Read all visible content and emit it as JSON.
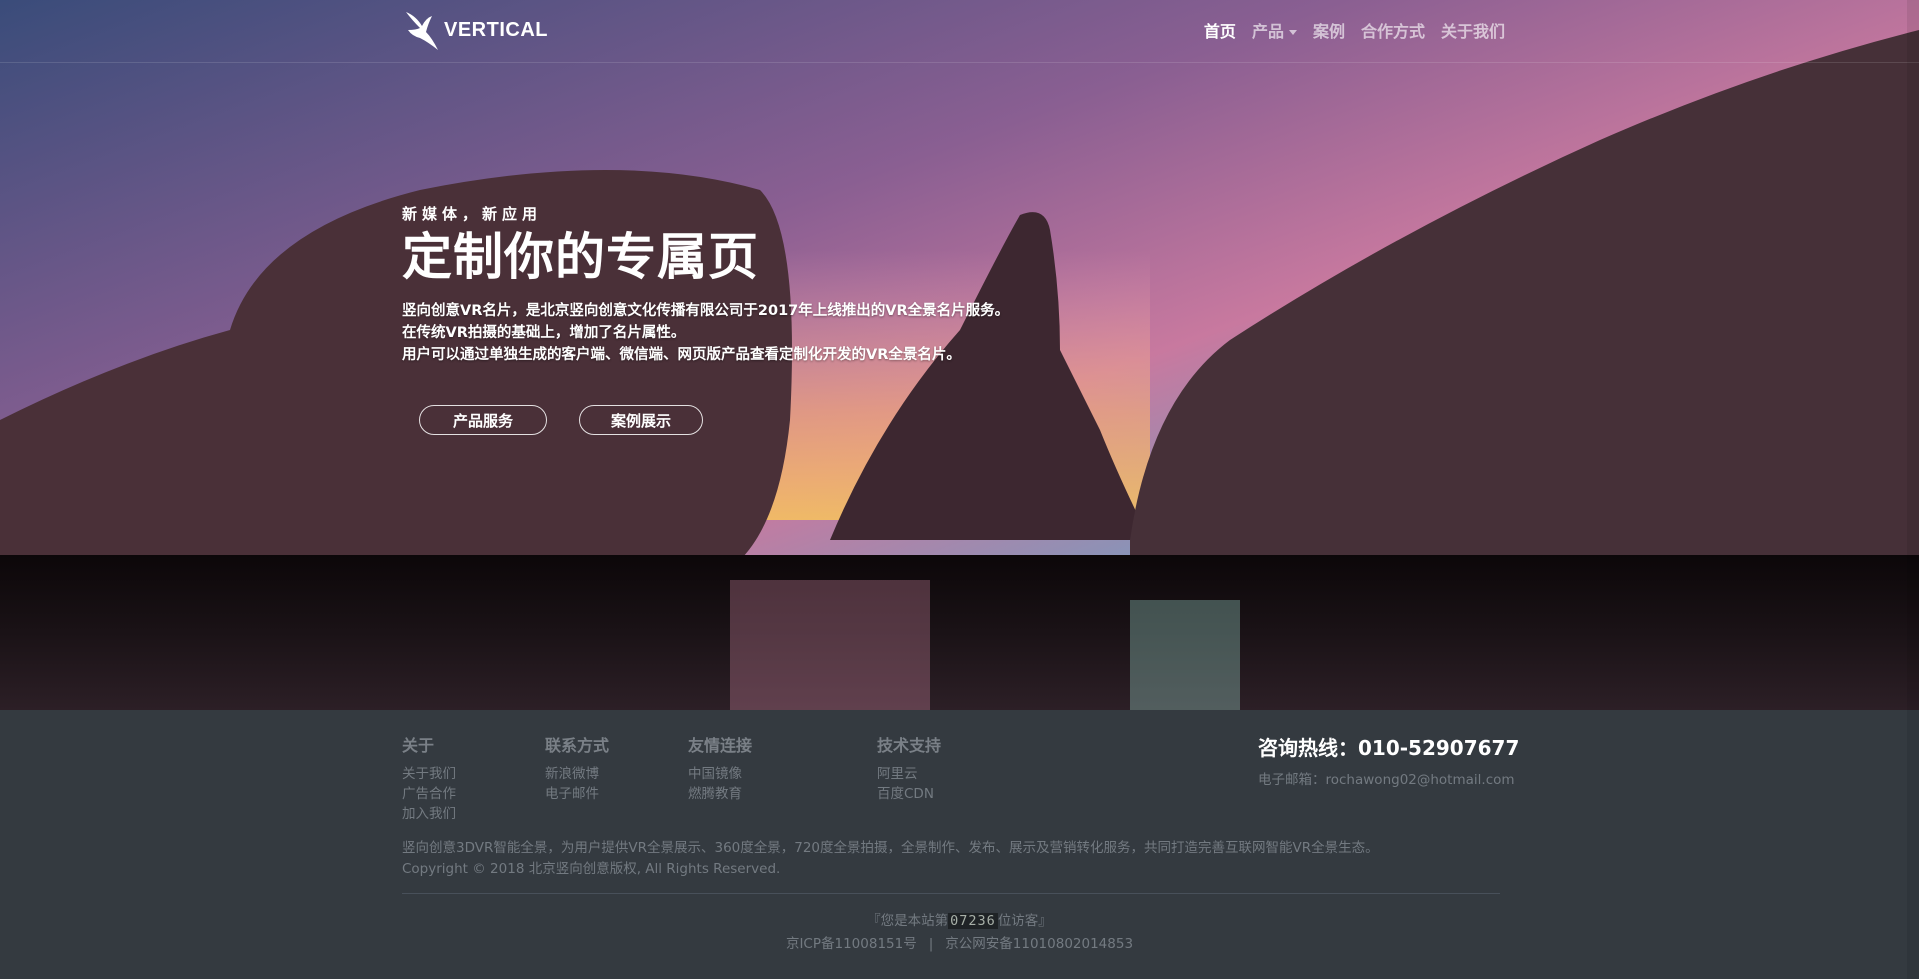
{
  "brand": {
    "name": "VERTICAL"
  },
  "nav": {
    "items": [
      {
        "label": "首页",
        "active": true
      },
      {
        "label": "产品",
        "dropdown": true
      },
      {
        "label": "案例"
      },
      {
        "label": "合作方式"
      },
      {
        "label": "关于我们"
      }
    ]
  },
  "hero": {
    "subtitle": "新媒体，新应用",
    "title": "定制你的专属页",
    "description": [
      "竖向创意VR名片，是北京竖向创意文化传播有限公司于2017年上线推出的VR全景名片服务。",
      "在传统VR拍摄的基础上，增加了名片属性。",
      "用户可以通过单独生成的客户端、微信端、网页版产品查看定制化开发的VR全景名片。"
    ],
    "buttons": [
      "产品服务",
      "案例展示"
    ]
  },
  "footer": {
    "columns": [
      {
        "title": "关于",
        "links": [
          "关于我们",
          "广告合作",
          "加入我们"
        ]
      },
      {
        "title": "联系方式",
        "links": [
          "新浪微博",
          "电子邮件"
        ]
      },
      {
        "title": "友情连接",
        "links": [
          "中国镜像",
          "燃腾教育"
        ]
      },
      {
        "title": "技术支持",
        "links": [
          "阿里云",
          "百度CDN"
        ]
      }
    ],
    "hotline": "咨询热线：010-52907677",
    "email": "电子邮箱：rochawong02@hotmail.com",
    "about_text": "竖向创意3DVR智能全景，为用户提供VR全景展示、360度全景，720度全景拍摄，全景制作、发布、展示及营销转化服务，共同打造完善互联网智能VR全景生态。",
    "copyright": "Copyright © 2018 北京竖向创意版权, All Rights Reserved.",
    "visitor_prefix": "『您是本站第",
    "visitor_count": "07236",
    "visitor_suffix": "位访客』",
    "icp": "京ICP备11008151号",
    "separator": "|",
    "police": "京公网安备11010802014853"
  },
  "colors": {
    "footer_bg": "#343a40",
    "footer_text": "#737a81",
    "nav_active": "#ffffff"
  }
}
